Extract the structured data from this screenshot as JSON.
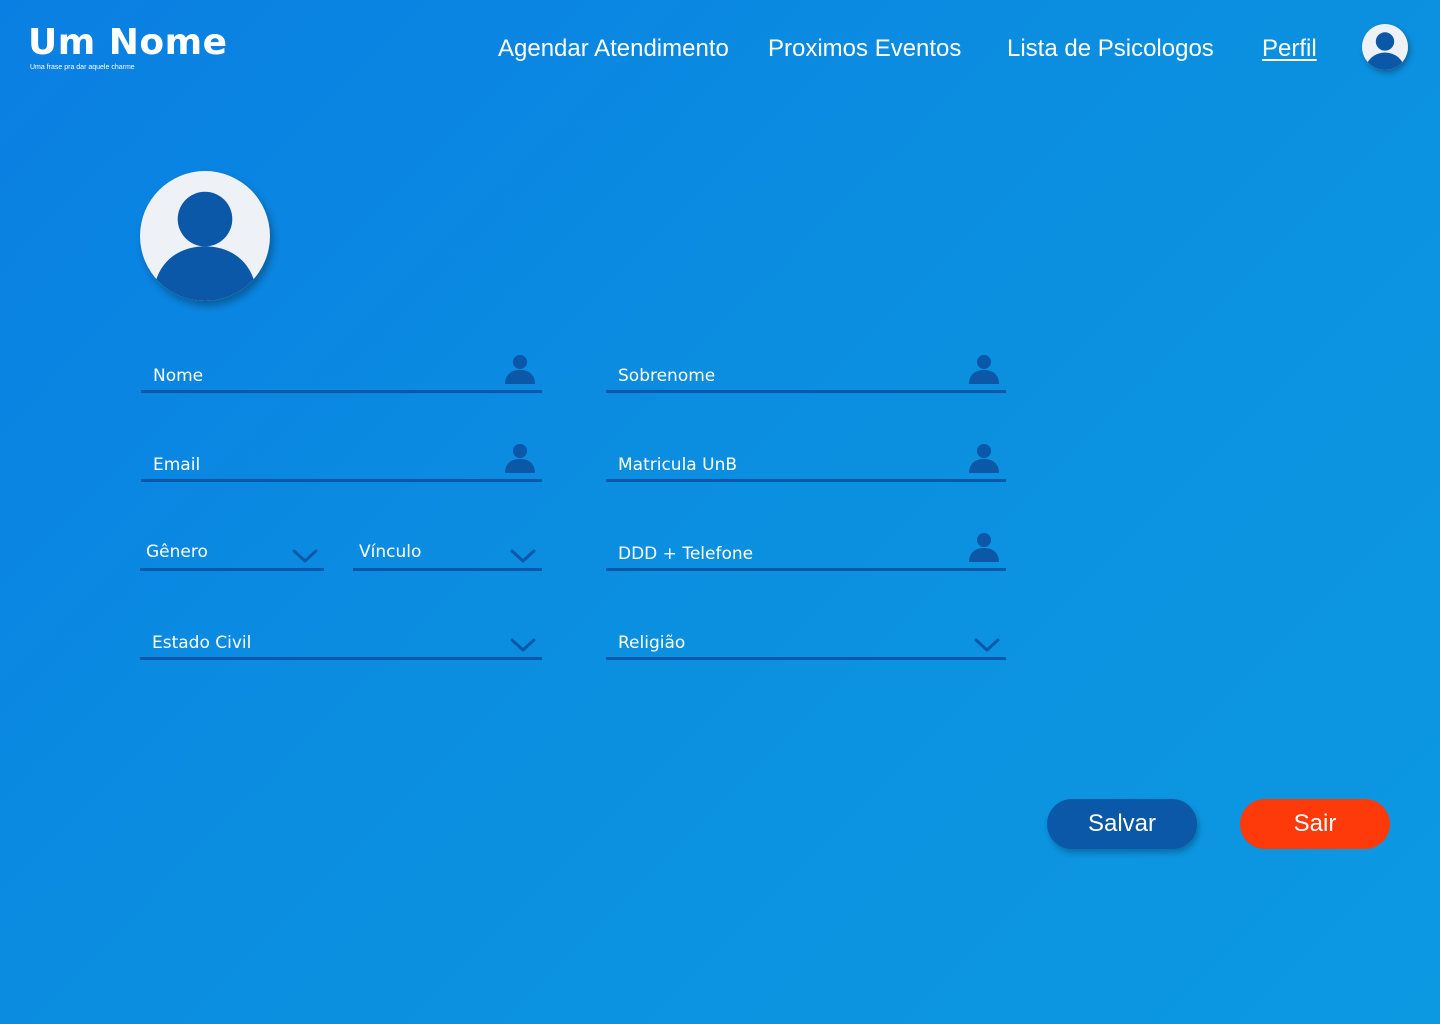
{
  "brand": {
    "title": "Um Nome",
    "tagline": "Uma frase pra dar aquele charme"
  },
  "nav": {
    "items": [
      {
        "label": "Agendar Atendimento",
        "active": false
      },
      {
        "label": "Proximos Eventos",
        "active": false
      },
      {
        "label": "Lista de Psicologos",
        "active": false
      },
      {
        "label": "Perfil",
        "active": true
      }
    ]
  },
  "form": {
    "nome": {
      "label": "Nome",
      "icon": "user-icon"
    },
    "sobrenome": {
      "label": "Sobrenome",
      "icon": "user-icon"
    },
    "email": {
      "label": "Email",
      "icon": "user-icon"
    },
    "matricula": {
      "label": "Matricula UnB",
      "icon": "user-icon"
    },
    "genero": {
      "label": "Gênero",
      "icon": "chevron-down-icon"
    },
    "vinculo": {
      "label": "Vínculo",
      "icon": "chevron-down-icon"
    },
    "telefone": {
      "label": "DDD + Telefone",
      "icon": "user-icon"
    },
    "estado_civil": {
      "label": "Estado Civil",
      "icon": "chevron-down-icon"
    },
    "religiao": {
      "label": "Religião",
      "icon": "chevron-down-icon"
    }
  },
  "actions": {
    "save_label": "Salvar",
    "exit_label": "Sair"
  },
  "colors": {
    "background": "#0b8fe0",
    "accent_dark_blue": "#0b57a8",
    "danger": "#ff3a0a",
    "avatar_bg": "#eef1f5"
  }
}
